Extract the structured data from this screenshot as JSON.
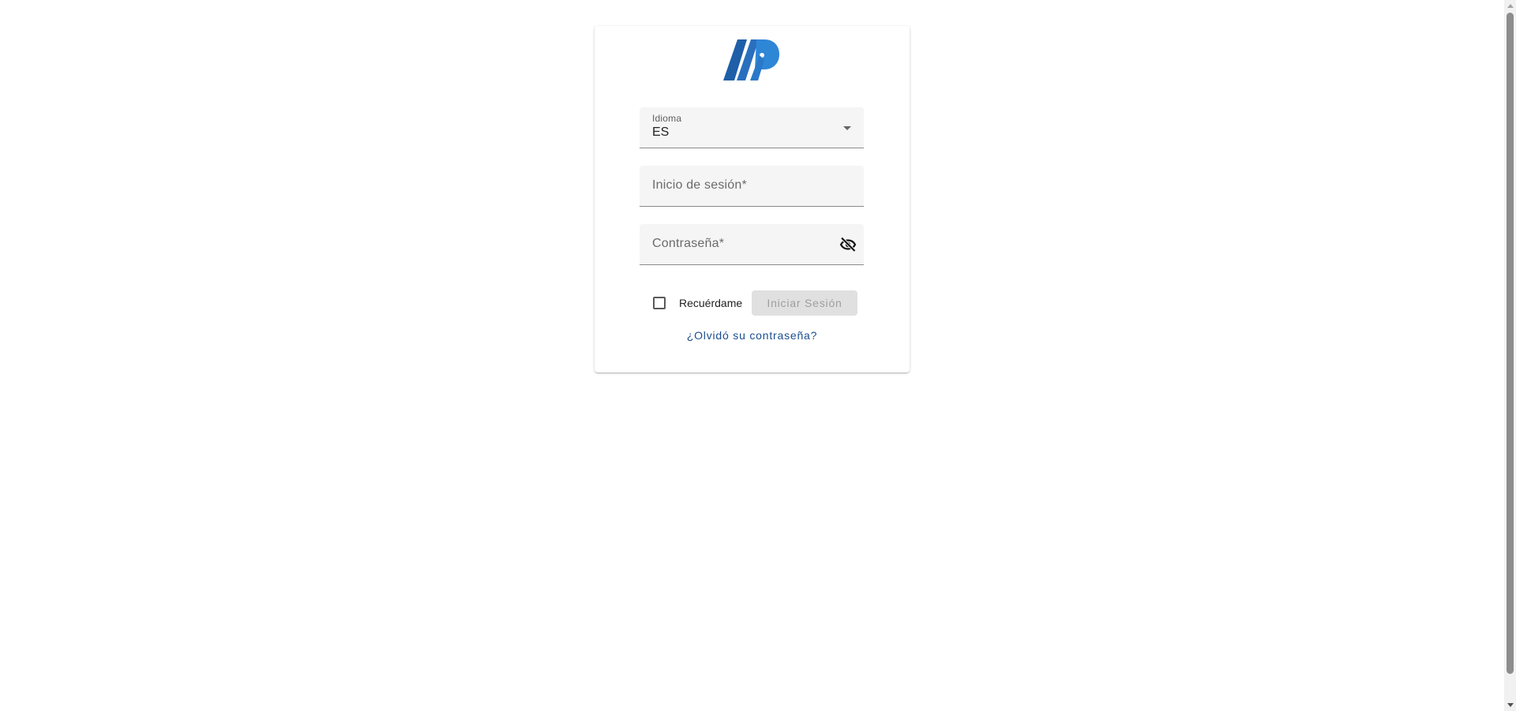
{
  "login": {
    "logo_icon": "ap-logo-icon",
    "brand_colors": {
      "primary_dark": "#1f5fa8",
      "primary_light": "#2e86d6",
      "link": "#1a4d8f"
    },
    "language": {
      "label": "Idioma",
      "value": "ES",
      "icon": "dropdown-caret-icon"
    },
    "username": {
      "placeholder": "Inicio de sesión*",
      "value": ""
    },
    "password": {
      "placeholder": "Contraseña*",
      "value": "",
      "toggle_icon": "eye-off-icon"
    },
    "remember": {
      "label": "Recuérdame",
      "checked": false
    },
    "submit_label": "Iniciar Sesión",
    "submit_disabled": true,
    "forgot_label": "¿Olvidó su contraseña?"
  }
}
